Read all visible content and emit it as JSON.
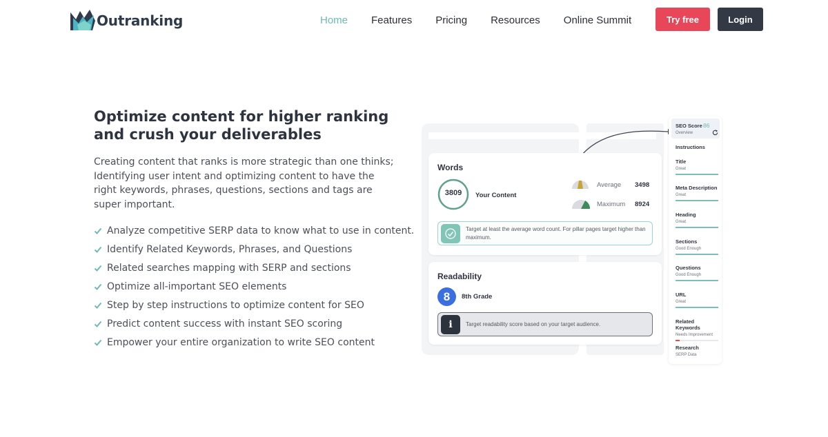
{
  "header": {
    "brand": "Outranking",
    "nav": [
      "Home",
      "Features",
      "Pricing",
      "Resources",
      "Online Summit"
    ],
    "try_label": "Try free",
    "login_label": "Login",
    "accent": "#6fb9b6",
    "brand_red": "#e8475a",
    "dark": "#333a46"
  },
  "hero": {
    "headline": "Optimize content for higher ranking and crush your deliverables",
    "intro": "Creating content that ranks is more strategic than one thinks; Identifying user intent and optimizing content to have the right keywords, phrases, questions, sections and tags are super important.",
    "features": [
      "Analyze competitive SERP data to know what to use in content.",
      "Identify Related Keywords, Phrases, and Questions",
      "Related searches mapping with SERP and sections",
      "Optimize all-important SEO elements",
      "Step by step instructions to optimize content for SEO",
      "Predict content success with instant SEO scoring",
      "Empower your entire organization to write SEO content"
    ],
    "check_icon": "check-icon"
  },
  "illustration": {
    "words": {
      "title": "Words",
      "value": "3809",
      "your_content": "Your Content",
      "average_label": "Average",
      "average_value": "3498",
      "maximum_label": "Maximum",
      "maximum_value": "8924",
      "note": "Target at least the average word count. For pillar pages target higher than maximum."
    },
    "readability": {
      "title": "Readability",
      "grade_number": "8",
      "grade_label": "8th Grade",
      "note": "Target readability score based on your target audience."
    },
    "seo_score": {
      "label": "SEO Score",
      "value": "86",
      "overview": "Overview",
      "instructions": "Instructions",
      "items": [
        {
          "title": "Title",
          "status": "Great"
        },
        {
          "title": "Meta Description",
          "status": "Great"
        },
        {
          "title": "Heading",
          "status": "Great"
        },
        {
          "title": "Sections",
          "status": "Good Enough"
        },
        {
          "title": "Questions",
          "status": "Good Enough"
        },
        {
          "title": "URL",
          "status": "Great"
        },
        {
          "title": "Related Keywords",
          "status": "Needs Improvement"
        },
        {
          "title": "Research",
          "status": "SERP Data"
        }
      ]
    }
  }
}
